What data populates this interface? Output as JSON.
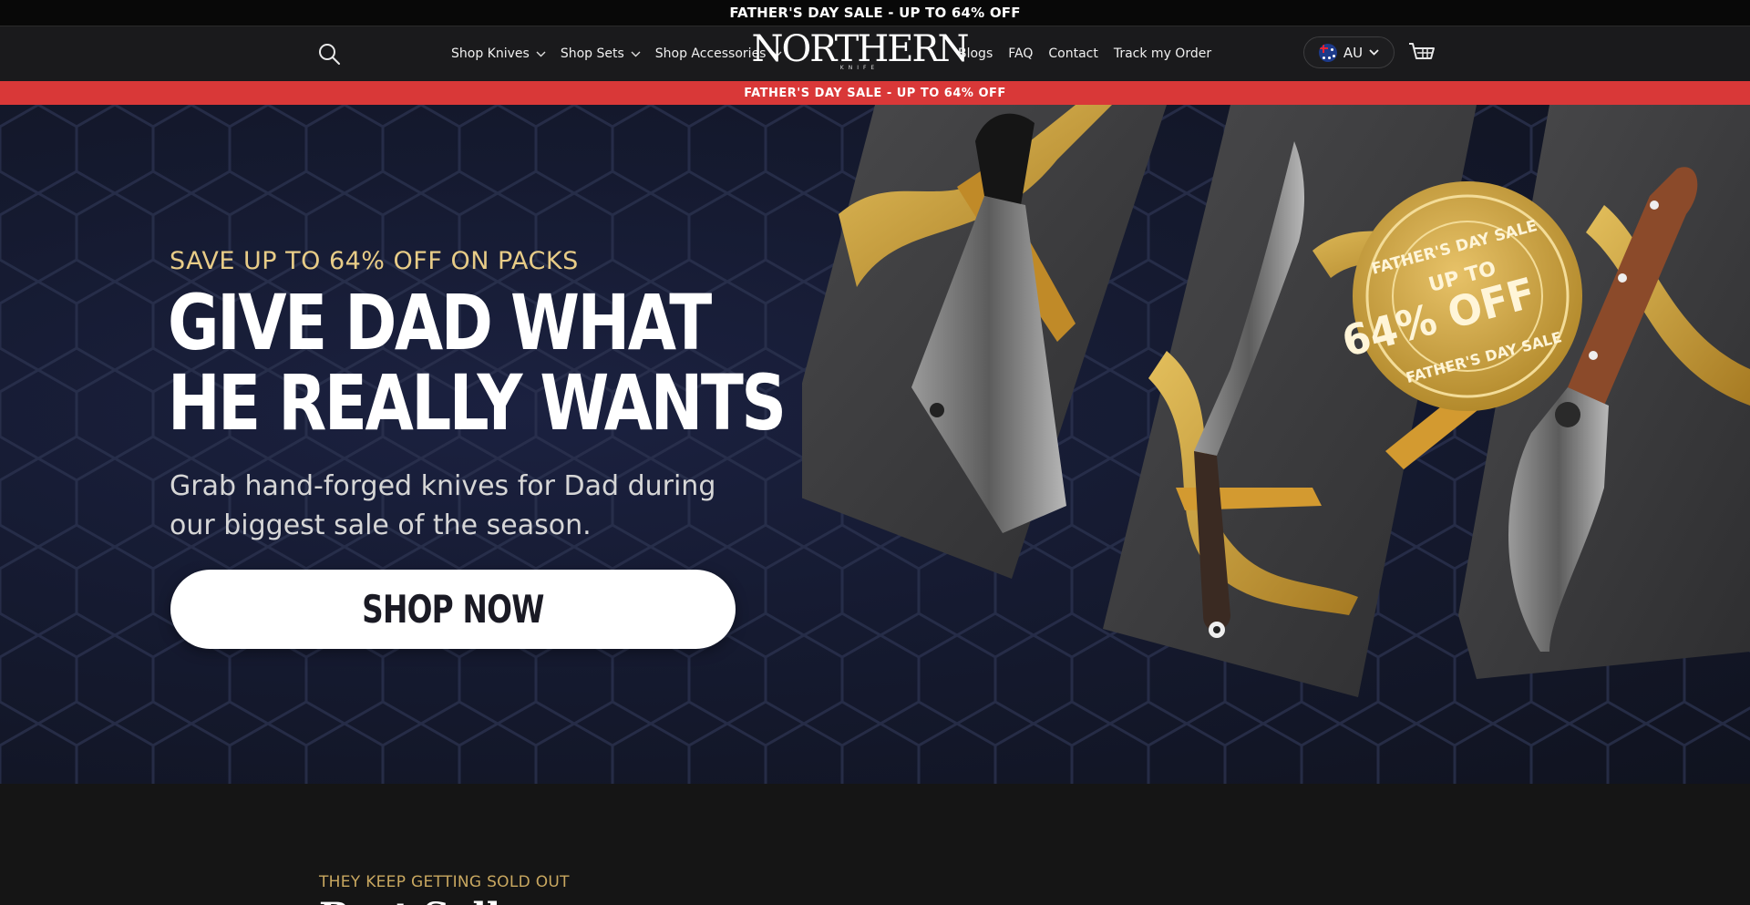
{
  "announcement": {
    "text": "FATHER'S DAY SALE - UP TO 64% OFF"
  },
  "header": {
    "nav_left": [
      {
        "label": "Shop Knives",
        "has_dropdown": true
      },
      {
        "label": "Shop Sets",
        "has_dropdown": true
      },
      {
        "label": "Shop Accessories",
        "has_dropdown": true
      }
    ],
    "logo": {
      "word": "NORTHERN",
      "sub": "KNIFE"
    },
    "nav_right": [
      {
        "label": "Blogs"
      },
      {
        "label": "FAQ"
      },
      {
        "label": "Contact"
      },
      {
        "label": "Track my Order"
      }
    ],
    "locale": {
      "country": "AU",
      "flag": "australia-flag"
    },
    "icons": {
      "search": "search-icon",
      "cart": "cart-icon"
    }
  },
  "promo_strip": {
    "text": "FATHER'S DAY SALE - UP TO 64% OFF",
    "color": "#d93838"
  },
  "hero": {
    "eyebrow": "SAVE UP TO 64% OFF ON PACKS",
    "title_line1": "GIVE DAD WHAT",
    "title_line2": "HE REALLY WANTS",
    "subtitle": "Grab hand-forged knives for Dad during our biggest sale of the season.",
    "cta": "SHOP NOW",
    "badge": {
      "top": "FATHER'S DAY SALE",
      "middle": "UP TO",
      "value": "64% OFF",
      "bottom": "FATHER'S DAY SALE"
    },
    "accent_color": "#e8cc87"
  },
  "best_sellers": {
    "eyebrow": "THEY KEEP GETTING SOLD OUT",
    "title": "Best Sellers"
  }
}
